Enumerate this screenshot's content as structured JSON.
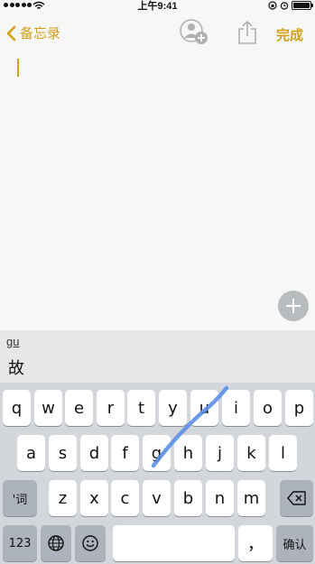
{
  "status_bar": {
    "time": "上午9:41"
  },
  "nav": {
    "back_label": "备忘录",
    "done_label": "完成"
  },
  "candidate_bar": {
    "pinyin": "gu",
    "candidates": [
      "故"
    ]
  },
  "keyboard": {
    "row1": [
      "q",
      "w",
      "e",
      "r",
      "t",
      "y",
      "u",
      "i",
      "o",
      "p"
    ],
    "row2": [
      "a",
      "s",
      "d",
      "f",
      "g",
      "h",
      "j",
      "k",
      "l"
    ],
    "row3": [
      "z",
      "x",
      "c",
      "v",
      "b",
      "n",
      "m"
    ],
    "shift_label": "'词",
    "num_label": "123",
    "comma_label": "，",
    "confirm_label": "确认",
    "space_label": ""
  },
  "icons": {
    "back": "chevron-left-icon",
    "collab": "add-person-icon",
    "share": "share-icon",
    "globe": "globe-icon",
    "emoji": "emoji-icon",
    "delete": "delete-icon",
    "add": "plus-icon"
  },
  "colors": {
    "accent": "#d4a017",
    "swipe": "#5b8fe6"
  }
}
